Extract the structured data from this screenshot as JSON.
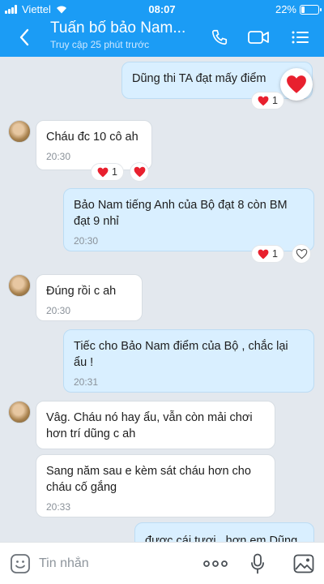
{
  "status_bar": {
    "carrier": "Viettel",
    "time": "08:07",
    "battery": "22%",
    "battery_level": 0.22
  },
  "header": {
    "title": "Tuấn bố bảo Nam...",
    "subtitle": "Truy cập 25 phút trước"
  },
  "messages": [
    {
      "text": "Dũng thi TA đạt mấy điểm",
      "reaction_count": "1"
    },
    {
      "text": "Cháu đc 10 cô ah",
      "time": "20:30",
      "reaction_count": "1"
    },
    {
      "text": "Bảo Nam tiếng Anh của Bộ đạt 8 còn BM đạt 9 nhỉ",
      "time": "20:30",
      "reaction_count": "1"
    },
    {
      "text": "Đúng rồi c ah",
      "time": "20:30"
    },
    {
      "text": "Tiếc cho Bảo Nam điểm của Bộ , chắc lại ẩu !",
      "time": "20:31"
    },
    {
      "text": "Vâg. Cháu nó hay ẩu, vẫn còn mải chơi hơn trí dũng c ah"
    },
    {
      "text": "Sang năm sau e kèm sát cháu hơn cho cháu cố gắng",
      "time": "20:33"
    },
    {
      "text": "được cái tươi , hơn em Dũng"
    }
  ],
  "input": {
    "placeholder": "Tin nhắn"
  },
  "colors": {
    "header": "#1b9cf5",
    "outgoing_bubble": "#d9efff",
    "incoming_bubble": "#ffffff",
    "heart": "#e8202e"
  }
}
